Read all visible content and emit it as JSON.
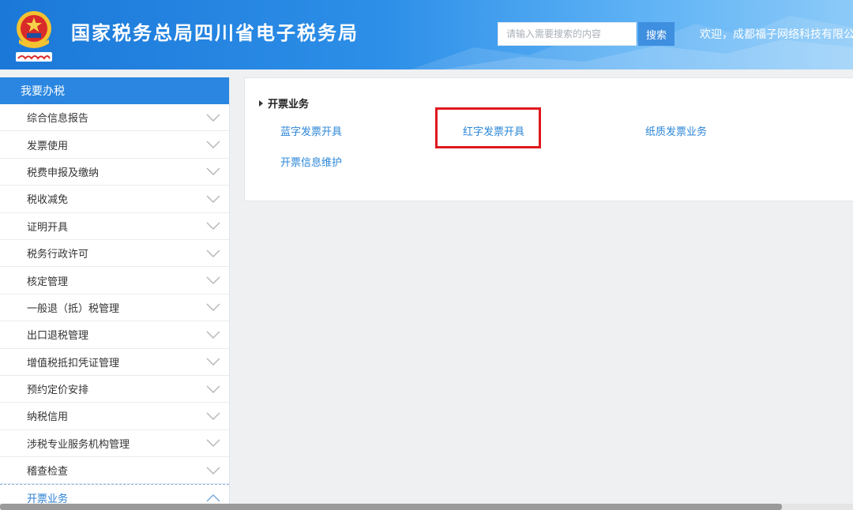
{
  "header": {
    "title": "国家税务总局四川省电子税务局",
    "search_placeholder": "请输入需要搜索的内容",
    "search_button": "搜索",
    "welcome_text": "欢迎，成都福子网络科技有限公"
  },
  "sidebar": {
    "heading": "我要办税",
    "items": [
      {
        "label": "综合信息报告"
      },
      {
        "label": "发票使用"
      },
      {
        "label": "税费申报及缴纳"
      },
      {
        "label": "税收减免"
      },
      {
        "label": "证明开具"
      },
      {
        "label": "税务行政许可"
      },
      {
        "label": "核定管理"
      },
      {
        "label": "一般退（抵）税管理"
      },
      {
        "label": "出口退税管理"
      },
      {
        "label": "增值税抵扣凭证管理"
      },
      {
        "label": "预约定价安排"
      },
      {
        "label": "纳税信用"
      },
      {
        "label": "涉税专业服务机构管理"
      },
      {
        "label": "稽查检查"
      },
      {
        "label": "开票业务"
      }
    ]
  },
  "content": {
    "section_title": "开票业务",
    "links": {
      "blue_invoice": "蓝字发票开具",
      "red_invoice": "红字发票开具",
      "paper_invoice": "纸质发票业务",
      "invoice_info": "开票信息维护"
    }
  },
  "colors": {
    "header_blue": "#1b78d8",
    "link_blue": "#2a86d8",
    "highlight_red": "#e0181f"
  }
}
